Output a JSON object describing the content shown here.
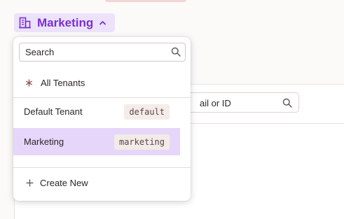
{
  "tenant_switcher": {
    "current": "Marketing",
    "icon": "building-icon",
    "chevron_icon": "chevron-up-icon",
    "accent_color": "#7b2fd2"
  },
  "background": {
    "search_text": "ail or ID"
  },
  "dropdown": {
    "search_placeholder": "Search",
    "all_tenants_label": "All Tenants",
    "tenants": [
      {
        "label": "Default Tenant",
        "slug": "default",
        "selected": false
      },
      {
        "label": "Marketing",
        "slug": "marketing",
        "selected": true
      }
    ],
    "create_label": "Create New"
  }
}
